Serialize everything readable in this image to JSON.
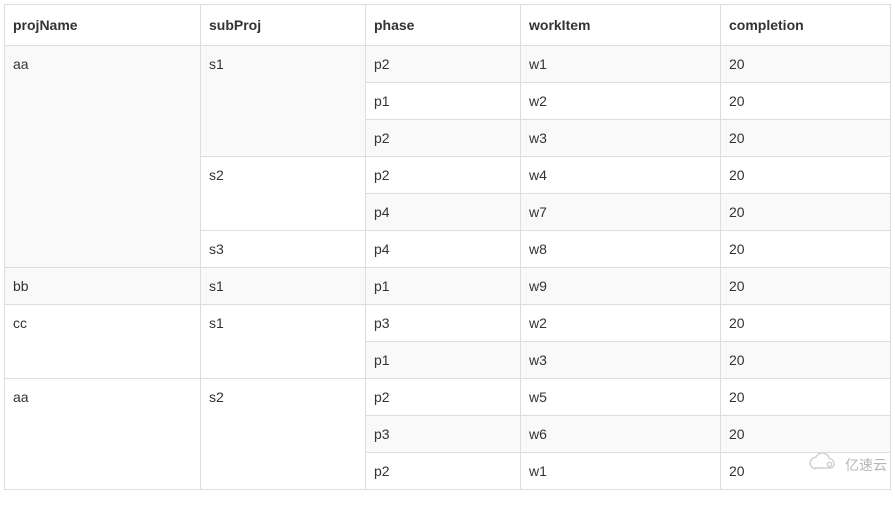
{
  "table": {
    "headers": {
      "projName": "projName",
      "subProj": "subProj",
      "phase": "phase",
      "workItem": "workItem",
      "completion": "completion"
    },
    "rows": [
      {
        "projName": "aa",
        "subProj": "s1",
        "phase": "p2",
        "workItem": "w1",
        "completion": "20"
      },
      {
        "projName": "",
        "subProj": "",
        "phase": "p1",
        "workItem": "w2",
        "completion": "20"
      },
      {
        "projName": "",
        "subProj": "",
        "phase": "p2",
        "workItem": "w3",
        "completion": "20"
      },
      {
        "projName": "",
        "subProj": "s2",
        "phase": "p2",
        "workItem": "w4",
        "completion": "20"
      },
      {
        "projName": "",
        "subProj": "",
        "phase": "p4",
        "workItem": "w7",
        "completion": "20"
      },
      {
        "projName": "",
        "subProj": "s3",
        "phase": "p4",
        "workItem": "w8",
        "completion": "20"
      },
      {
        "projName": "bb",
        "subProj": "s1",
        "phase": "p1",
        "workItem": "w9",
        "completion": "20"
      },
      {
        "projName": "cc",
        "subProj": "s1",
        "phase": "p3",
        "workItem": "w2",
        "completion": "20"
      },
      {
        "projName": "",
        "subProj": "",
        "phase": "p1",
        "workItem": "w3",
        "completion": "20"
      },
      {
        "projName": "aa",
        "subProj": "s2",
        "phase": "p2",
        "workItem": "w5",
        "completion": "20"
      },
      {
        "projName": "",
        "subProj": "",
        "phase": "p3",
        "workItem": "w6",
        "completion": "20"
      },
      {
        "projName": "",
        "subProj": "",
        "phase": "p2",
        "workItem": "w1",
        "completion": "20"
      }
    ]
  },
  "watermark": {
    "text": "亿速云"
  }
}
